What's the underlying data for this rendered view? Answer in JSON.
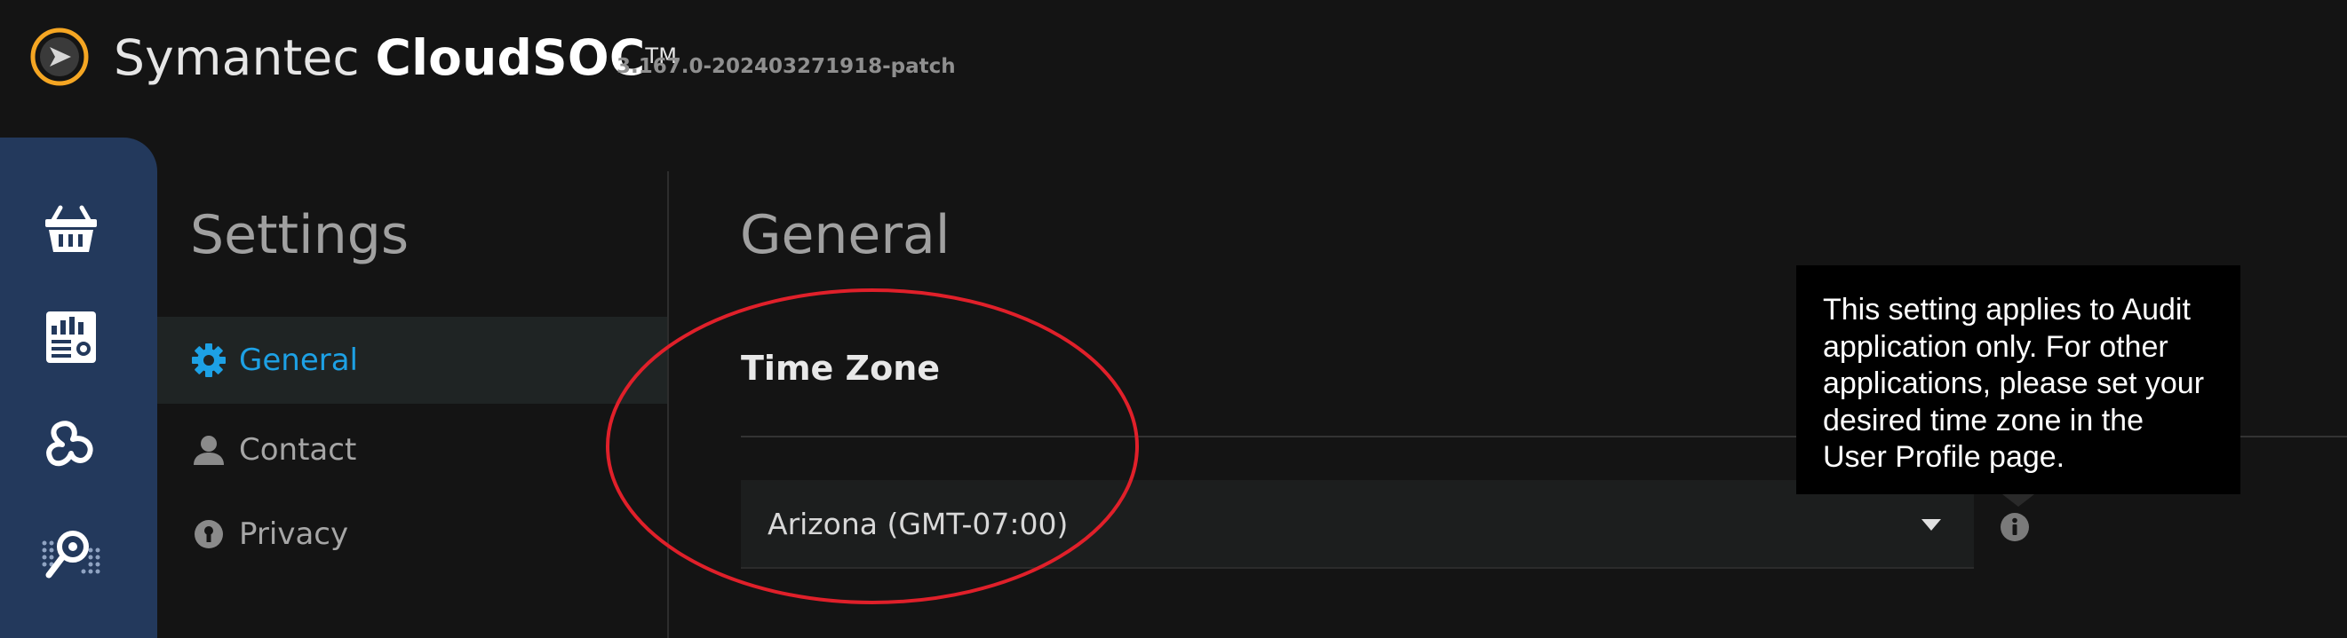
{
  "header": {
    "brand_name": "Symantec",
    "product_name": "CloudSOC",
    "trademark": "TM",
    "version": "3.167.0-202403271918-patch",
    "logo_icon": "symantec-logo-icon"
  },
  "rail": {
    "items": [
      {
        "icon": "basket-icon"
      },
      {
        "icon": "dashboard-report-icon"
      },
      {
        "icon": "cloud-apps-icon"
      },
      {
        "icon": "investigate-search-icon"
      }
    ]
  },
  "sidebar": {
    "title": "Settings",
    "items": [
      {
        "label": "General",
        "icon": "gear-icon",
        "active": true
      },
      {
        "label": "Contact",
        "icon": "user-icon",
        "active": false
      },
      {
        "label": "Privacy",
        "icon": "lock-icon",
        "active": false
      }
    ]
  },
  "main": {
    "title": "General",
    "section_title": "Time Zone",
    "timezone": {
      "selected": "Arizona (GMT-07:00)",
      "caret_icon": "caret-down-icon",
      "info_icon": "info-icon"
    },
    "tooltip": {
      "lines": [
        "This setting applies to Audit",
        "application only. For other",
        "applications, please set your",
        "desired time zone in the",
        "User Profile page."
      ]
    }
  },
  "colors": {
    "background": "#141414",
    "rail": "#23395c",
    "accent": "#1da1e5",
    "logo": "#f5a623",
    "annotation": "#e0202a"
  }
}
